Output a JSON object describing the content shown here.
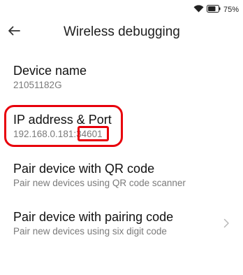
{
  "status_bar": {
    "battery_percent": "75%",
    "battery_level": 0.75,
    "icons": [
      "wifi-icon",
      "battery-icon"
    ]
  },
  "header": {
    "back_icon": "arrow-left-icon",
    "title": "Wireless debugging"
  },
  "items": [
    {
      "title": "Device name",
      "subtitle": "21051182G"
    },
    {
      "title": "IP address & Port",
      "subtitle": "192.168.0.181",
      "port": "34601"
    },
    {
      "title": "Pair device with QR code",
      "subtitle": "Pair new devices using QR code scanner"
    },
    {
      "title": "Pair device with pairing code",
      "subtitle": "Pair new devices using six digit code",
      "trailing_icon": "chevron-right-icon"
    }
  ],
  "colors": {
    "annotation": "#e8000b",
    "subtitle": "#7a7a7a",
    "title": "#111111"
  }
}
